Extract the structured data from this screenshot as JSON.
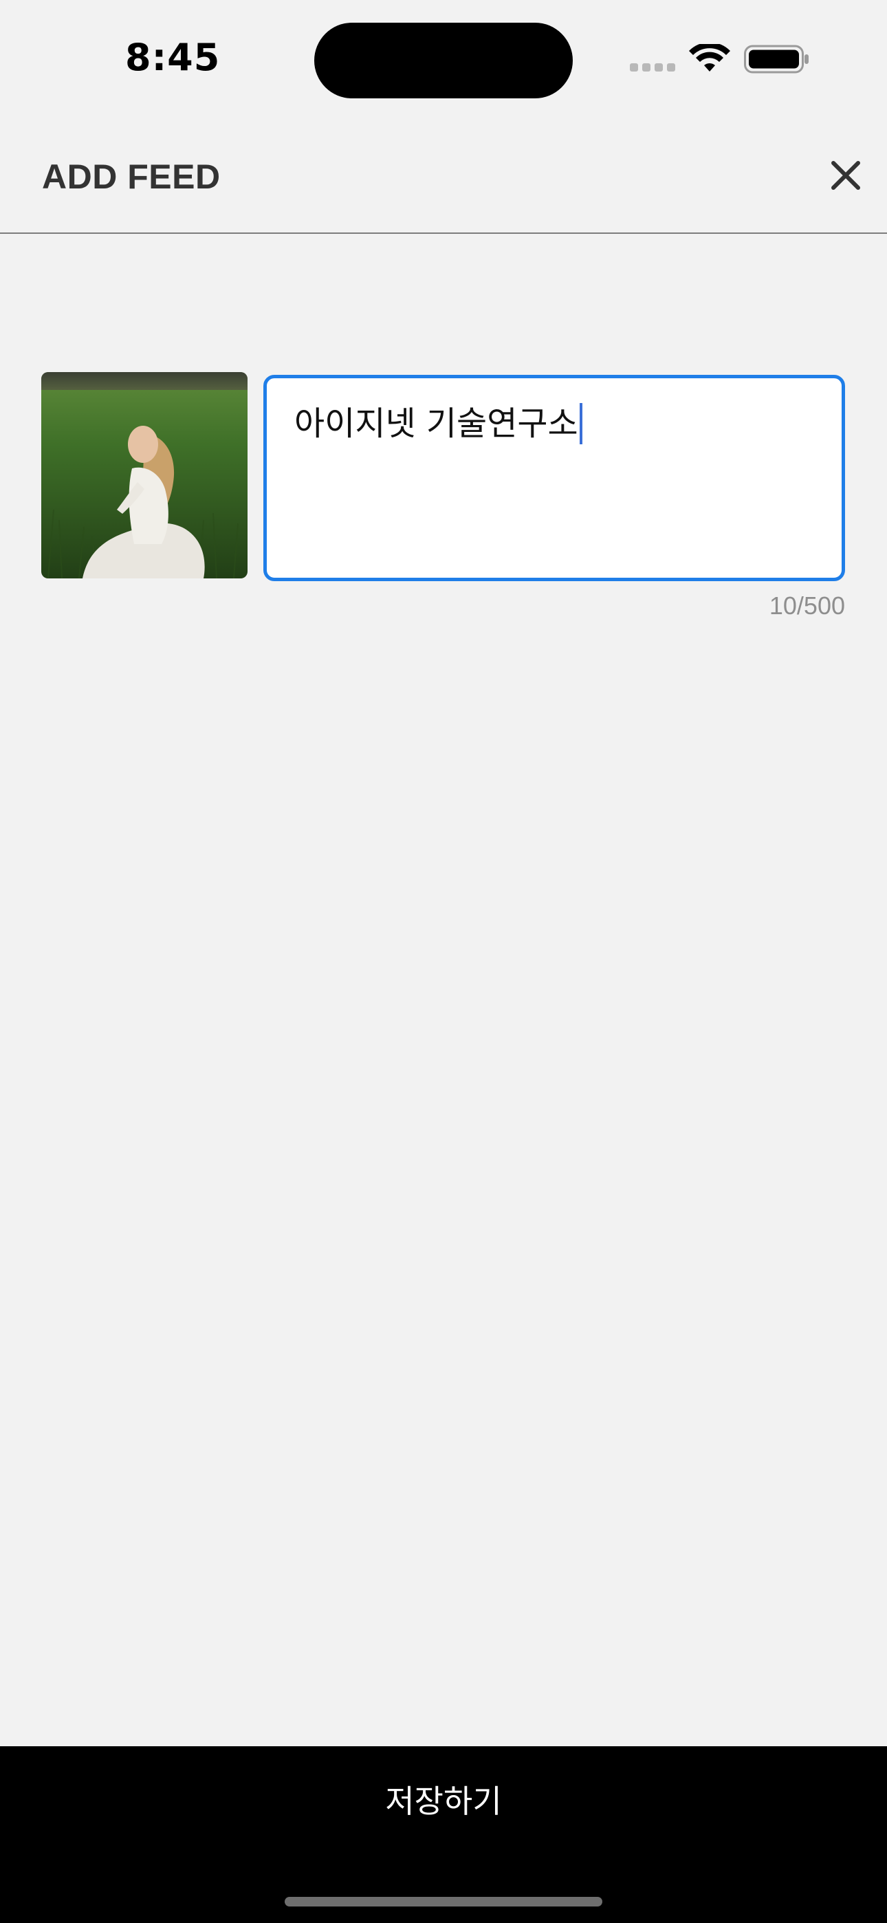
{
  "status_bar": {
    "time": "8:45",
    "icons": [
      "cellular-signal-icon",
      "wifi-icon",
      "battery-icon"
    ]
  },
  "header": {
    "title": "ADD FEED",
    "close_icon": "close-icon"
  },
  "feed": {
    "caption_value": "아이지넷 기술연구소",
    "char_counter": "10/500"
  },
  "footer": {
    "save_label": "저장하기"
  },
  "colors": {
    "background": "#f2f2f2",
    "input_border_focus": "#1f7ee8",
    "save_bar": "#000000",
    "counter_text": "#8e8e8e"
  }
}
